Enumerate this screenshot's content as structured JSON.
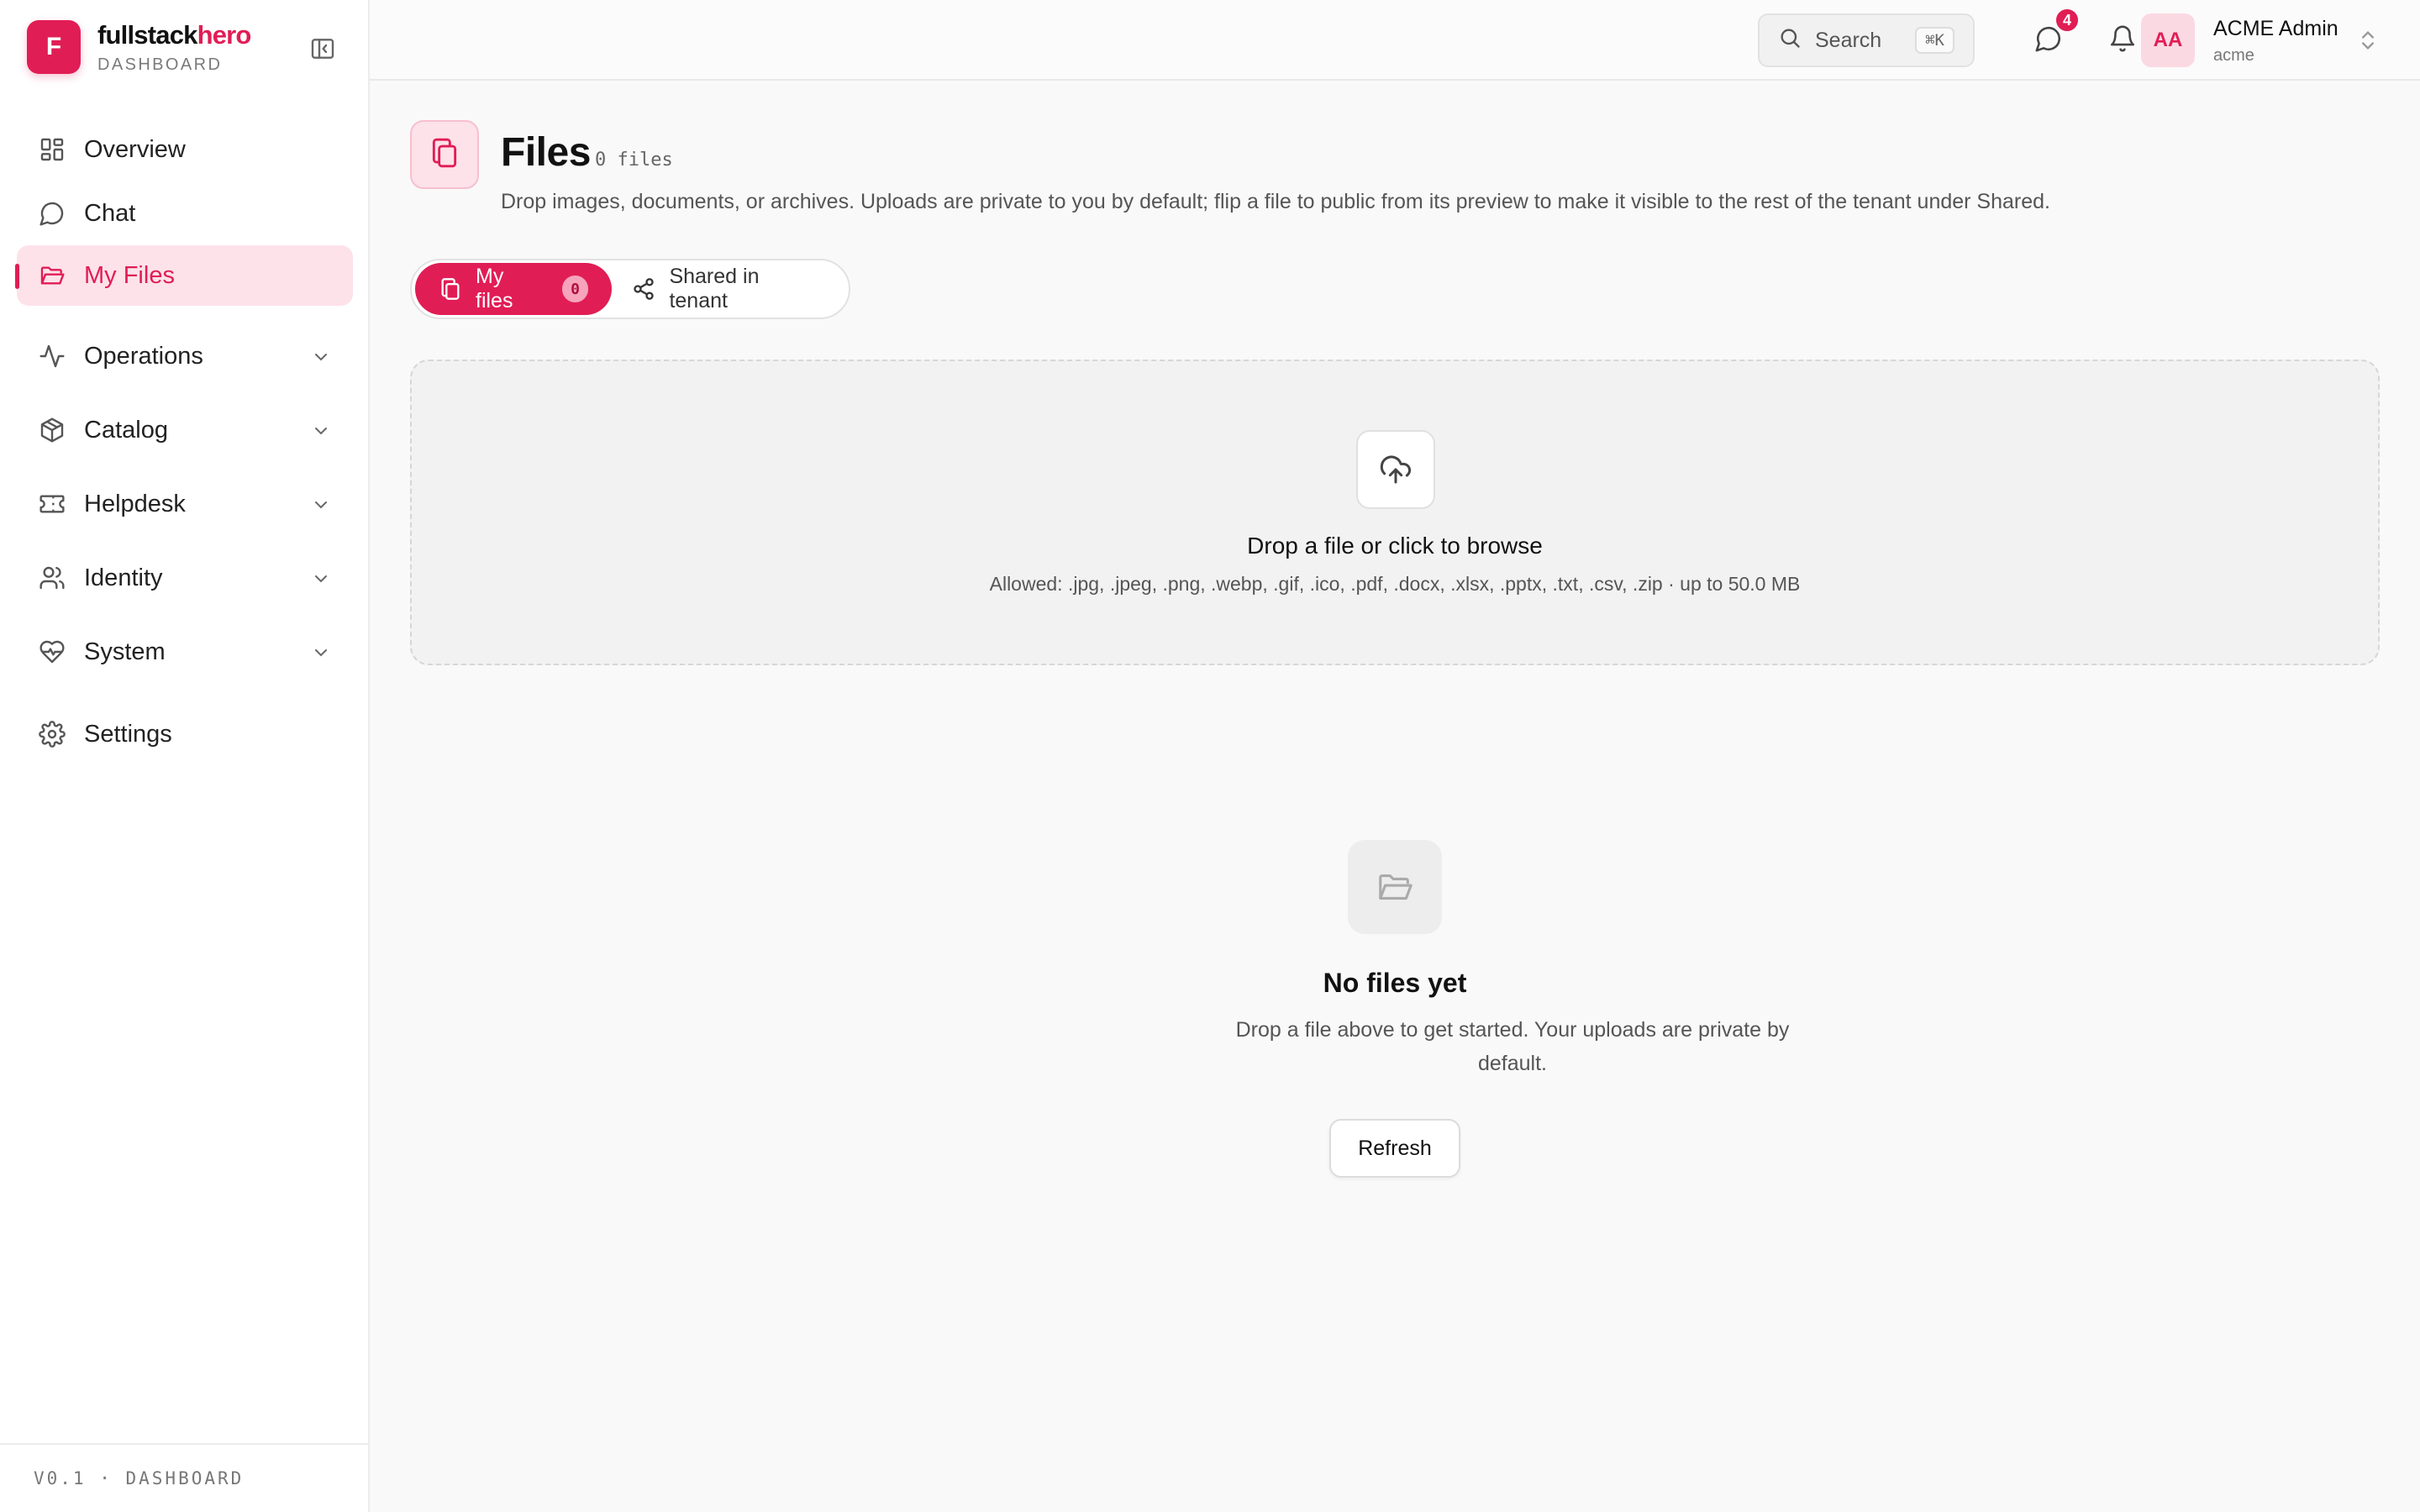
{
  "brand": {
    "logo_letter": "F",
    "name_main": "fullstack",
    "name_accent": "hero",
    "subtitle": "DASHBOARD",
    "accent_color": "#e11d55"
  },
  "sidebar": {
    "items": [
      {
        "label": "Overview",
        "icon": "grid-icon"
      },
      {
        "label": "Chat",
        "icon": "chat-bubble-icon"
      },
      {
        "label": "My Files",
        "icon": "folder-open-icon",
        "active": true
      },
      {
        "label": "Operations",
        "icon": "activity-icon",
        "expandable": true
      },
      {
        "label": "Catalog",
        "icon": "box-icon",
        "expandable": true
      },
      {
        "label": "Helpdesk",
        "icon": "ticket-icon",
        "expandable": true
      },
      {
        "label": "Identity",
        "icon": "users-icon",
        "expandable": true
      },
      {
        "label": "System",
        "icon": "heart-pulse-icon",
        "expandable": true
      },
      {
        "label": "Settings",
        "icon": "gear-icon"
      }
    ],
    "footer": "V0.1 · DASHBOARD"
  },
  "topbar": {
    "search": {
      "label": "Search",
      "shortcut": "⌘K"
    },
    "messages_badge": "4",
    "user": {
      "initials": "AA",
      "name": "ACME Admin",
      "org": "acme"
    }
  },
  "page": {
    "title": "Files",
    "count": "0 files",
    "description": "Drop images, documents, or archives. Uploads are private to you by default; flip a file to public from its preview to make it visible to the rest of the tenant under Shared."
  },
  "tabs": [
    {
      "label": "My files",
      "count": "0",
      "active": true
    },
    {
      "label": "Shared in tenant",
      "active": false
    }
  ],
  "dropzone": {
    "title": "Drop a file or click to browse",
    "allowed": "Allowed: .jpg, .jpeg, .png, .webp, .gif, .ico, .pdf, .docx, .xlsx, .pptx, .txt, .csv, .zip · up to 50.0 MB"
  },
  "empty_state": {
    "title": "No files yet",
    "description": "Drop a file above to get started. Your uploads are private by default.",
    "button": "Refresh"
  }
}
